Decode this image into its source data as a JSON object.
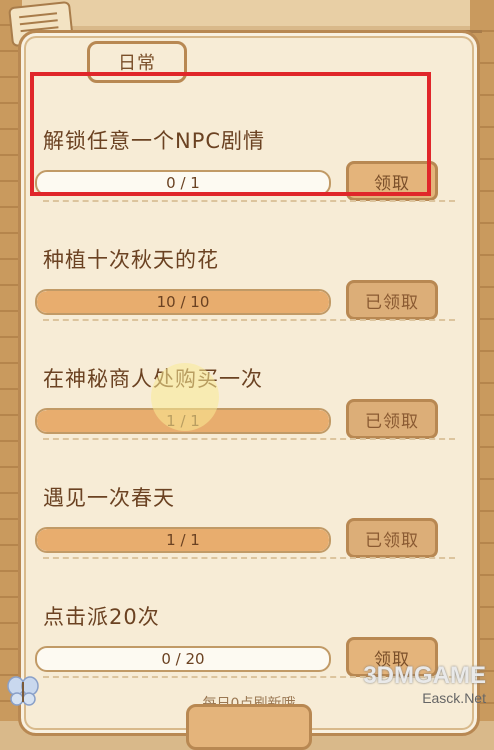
{
  "tab": {
    "label": "日常"
  },
  "quests": [
    {
      "title": "解锁任意一个NPC剧情",
      "progress_text": "0 / 1",
      "progress": 0.0,
      "button": "领取",
      "claimed": false
    },
    {
      "title": "种植十次秋天的花",
      "progress_text": "10 / 10",
      "progress": 1.0,
      "button": "已领取",
      "claimed": true
    },
    {
      "title": "在神秘商人处购买一次",
      "progress_text": "1 / 1",
      "progress": 1.0,
      "button": "已领取",
      "claimed": true
    },
    {
      "title": "遇见一次春天",
      "progress_text": "1 / 1",
      "progress": 1.0,
      "button": "已领取",
      "claimed": true
    },
    {
      "title": "点击派20次",
      "progress_text": "0 / 20",
      "progress": 0.0,
      "button": "领取",
      "claimed": false
    }
  ],
  "footer": {
    "note": "每日0点刷新哦"
  },
  "watermark": {
    "brand": "3DMGAME",
    "site": "Easck.Net"
  },
  "colors": {
    "highlight": "#e0262a",
    "fill": "#e8ad6e",
    "panel": "#f7ecd6",
    "border": "#b88852"
  }
}
